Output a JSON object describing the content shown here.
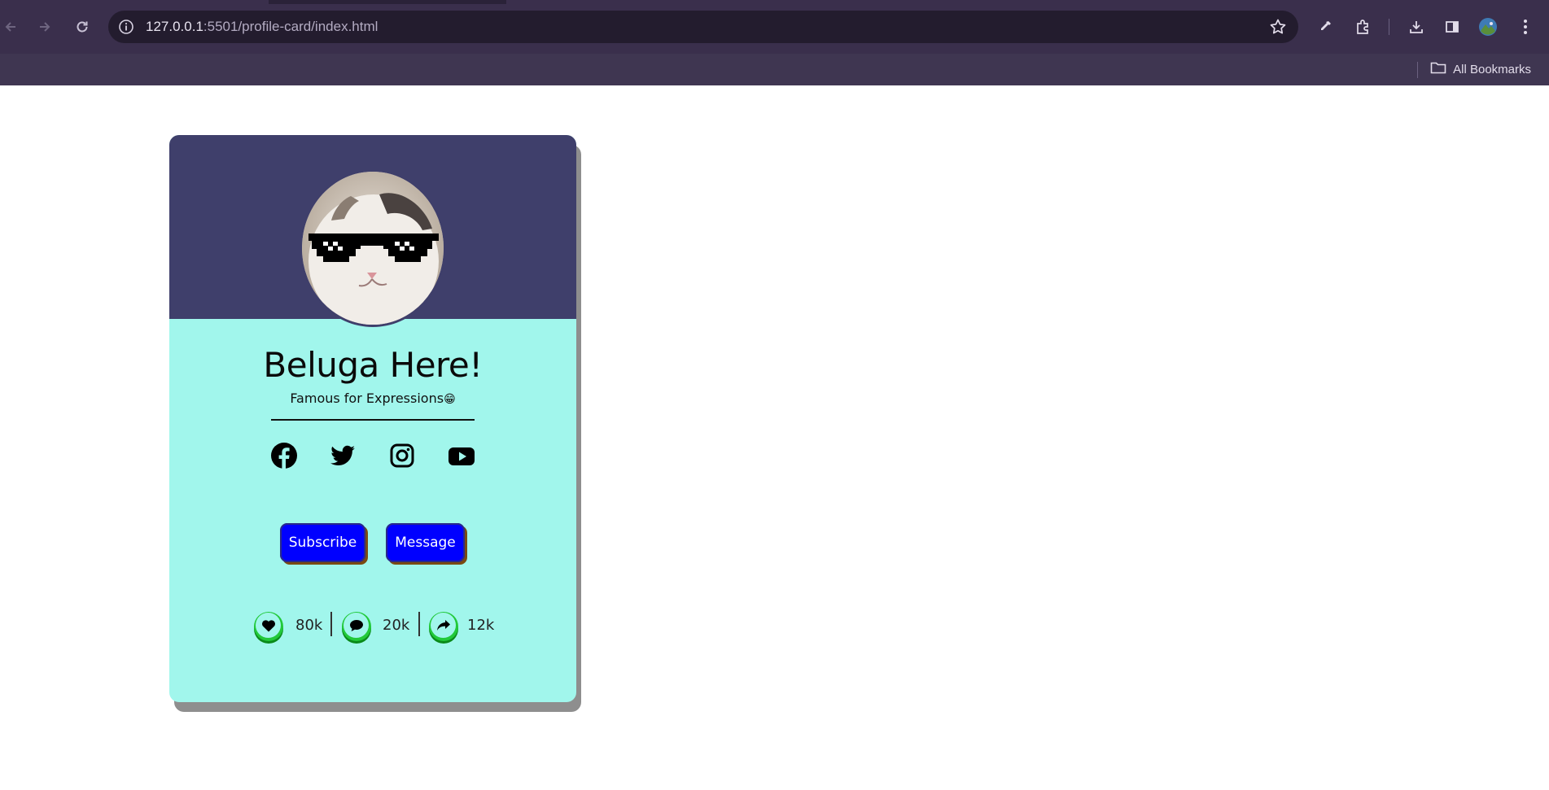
{
  "browser": {
    "url_host": "127.0.0.1",
    "url_rest": ":5501/profile-card/index.html",
    "bookmarks_label": "All Bookmarks"
  },
  "card": {
    "name": "Beluga Here!",
    "tagline": "Famous for Expressions",
    "tagline_emoji": "😁",
    "socials": [
      "facebook-icon",
      "twitter-icon",
      "instagram-icon",
      "youtube-icon"
    ],
    "buttons": {
      "subscribe": "Subscribe",
      "message": "Message"
    },
    "stats": {
      "likes": "80k",
      "comments": "20k",
      "shares": "12k"
    },
    "colors": {
      "header": "#3f3f6b",
      "body": "#a1f6ec",
      "button": "#0000ff",
      "stat_ring": "#22c93a"
    }
  }
}
